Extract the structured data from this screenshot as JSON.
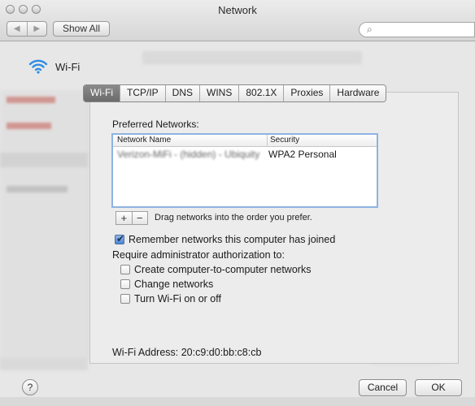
{
  "window": {
    "title": "Network"
  },
  "toolbar": {
    "back_label": "◀",
    "forward_label": "▶",
    "show_all_label": "Show All",
    "search_icon_glyph": "⌕"
  },
  "service": {
    "name": "Wi-Fi",
    "icon": "wifi-icon"
  },
  "tabs": [
    {
      "label": "Wi-Fi",
      "active": true
    },
    {
      "label": "TCP/IP",
      "active": false
    },
    {
      "label": "DNS",
      "active": false
    },
    {
      "label": "WINS",
      "active": false
    },
    {
      "label": "802.1X",
      "active": false
    },
    {
      "label": "Proxies",
      "active": false
    },
    {
      "label": "Hardware",
      "active": false
    }
  ],
  "preferred": {
    "label": "Preferred Networks:",
    "columns": {
      "name": "Network Name",
      "security": "Security"
    },
    "rows": [
      {
        "name": "Verizon-MiFi  -  (hidden)  -  Ubiquity",
        "security": "WPA2 Personal"
      }
    ],
    "add_label": "+",
    "remove_label": "−",
    "hint": "Drag networks into the order you prefer."
  },
  "options": {
    "remember": {
      "label": "Remember networks this computer has joined",
      "checked": true
    },
    "require_label": "Require administrator authorization to:",
    "items": [
      {
        "label": "Create computer-to-computer networks",
        "checked": false
      },
      {
        "label": "Change networks",
        "checked": false
      },
      {
        "label": "Turn Wi-Fi on or off",
        "checked": false
      }
    ]
  },
  "wifi_address": "Wi-Fi Address:  20:c9:d0:bb:c8:cb",
  "buttons": {
    "help": "?",
    "cancel": "Cancel",
    "ok": "OK"
  },
  "colors": {
    "active_tab": "#7a7a7a",
    "table_focus": "#8fb2e2",
    "wifi_icon": "#2f8be3"
  }
}
